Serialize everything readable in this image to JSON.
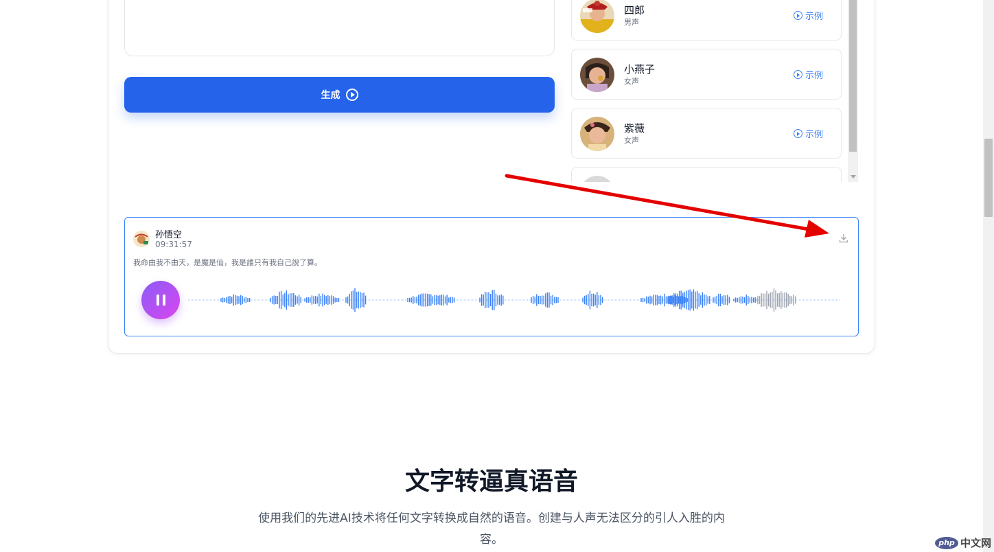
{
  "generate": {
    "label": "生成"
  },
  "voices": [
    {
      "name": "四郎",
      "gender": "男声",
      "sample": "示例"
    },
    {
      "name": "小燕子",
      "gender": "女声",
      "sample": "示例"
    },
    {
      "name": "紫薇",
      "gender": "女声",
      "sample": "示例"
    }
  ],
  "player": {
    "name": "孙悟空",
    "time": "09:31:57",
    "text": "我命由我不由天，是魔是仙，我是誰只有我自己說了算。"
  },
  "section": {
    "title": "文字转逼真语音",
    "subtitle": "使用我们的先进AI技术将任何文字转换成自然的语音。创建与人声无法区分的引人入胜的内容。"
  },
  "watermark": {
    "badge": "php",
    "text": "中文网"
  },
  "colors": {
    "primary": "#2563eb",
    "accent": "#3b82f6",
    "pause_gradient": [
      "#8b5cf6",
      "#d946ef"
    ],
    "arrow": "#e50000"
  }
}
